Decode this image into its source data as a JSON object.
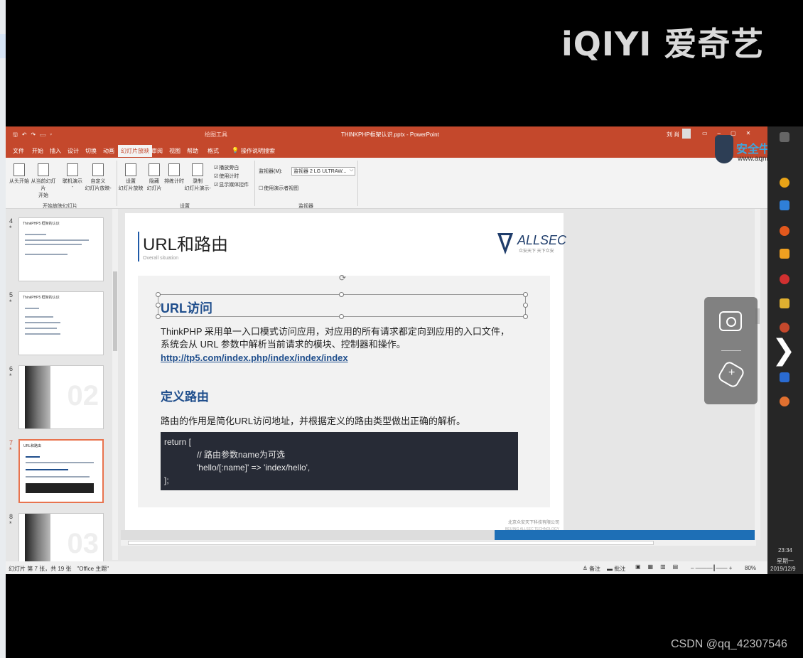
{
  "watermark": {
    "iqiyi": "iQIYI 爱奇艺",
    "csdn": "CSDN @qq_42307546"
  },
  "ppt": {
    "title_tool_tab": "绘图工具",
    "filename": "THINKPHP框架认识.pptx - PowerPoint",
    "user": "刘 肖",
    "tabs": [
      "文件",
      "开始",
      "插入",
      "设计",
      "切换",
      "动画",
      "幻灯片放映",
      "审阅",
      "视图",
      "帮助",
      "格式"
    ],
    "active_tab": "幻灯片放映",
    "tell_me": "操作说明搜索",
    "ribbon": {
      "buttons": [
        {
          "label": "从头开始",
          "sub": ""
        },
        {
          "label": "从当前幻灯片",
          "sub": "开始"
        },
        {
          "label": "联机演示",
          "sub": "-"
        },
        {
          "label": "自定义",
          "sub": "幻灯片放映-"
        },
        {
          "label": "设置",
          "sub": "幻灯片放映"
        },
        {
          "label": "隐藏",
          "sub": "幻灯片"
        },
        {
          "label": "排练计时",
          "sub": ""
        },
        {
          "label": "录制",
          "sub": "幻灯片演示-"
        }
      ],
      "checkboxes": [
        "播放旁白",
        "使用计时",
        "显示媒体控件"
      ],
      "presenter_checkbox": "使用演示者视图",
      "monitor_label": "监视器(M):",
      "monitor_value": "监视器 2 LG ULTRAW...",
      "groups": [
        "开始放映幻灯片",
        "设置",
        "监视器"
      ]
    },
    "thumbnails": [
      {
        "num": "4",
        "star": "*",
        "title": "ThinkPHP5 框架的认识"
      },
      {
        "num": "5",
        "star": "*",
        "title": "ThinkPHP5 框架的认识"
      },
      {
        "num": "6",
        "star": "*",
        "title": "02"
      },
      {
        "num": "7",
        "star": "*",
        "title": "URL和路由"
      },
      {
        "num": "8",
        "star": "*",
        "title": "03"
      }
    ],
    "slide": {
      "title": "URL和路由",
      "subtitle": "Overall situation",
      "logo_text": "ALLSEC",
      "logo_sub": "众安天下 天下众安",
      "h_url": "URL访问",
      "p1": "ThinkPHP 采用单一入口模式访问应用，对应用的所有请求都定向到应用的入口文件，系统会从 URL 参数中解析当前请求的模块、控制器和操作。",
      "link": "http://tp5.com/index.php/index/index/index",
      "h_route": "定义路由",
      "p2": "路由的作用是简化URL访问地址，并根据定义的路由类型做出正确的解析。",
      "code": [
        "return [",
        "// 路由参数name为可选",
        "'hello/[:name]' => 'index/hello',",
        "];"
      ],
      "footer_company": "北京众安天下科技有限公司",
      "footer_company_en": "BEIJING ALLSEC TECHNOLOGY CO.,LTD."
    },
    "status": {
      "left": "幻灯片 第 7 张，共 19 张　\"Office 主题\"",
      "notes": "备注",
      "comments": "批注",
      "zoom": "80%"
    },
    "video_progress": 0.41
  },
  "overlay_logo": {
    "text": "安全牛课堂",
    "url": "www.aqniukt"
  },
  "taskbar": {
    "time": "23:34",
    "weekday": "星期一",
    "date": "2019/12/9"
  },
  "colors": {
    "accent": "#c4482c",
    "title_blue": "#1f4e8c",
    "progress": "#1e6fb6"
  }
}
